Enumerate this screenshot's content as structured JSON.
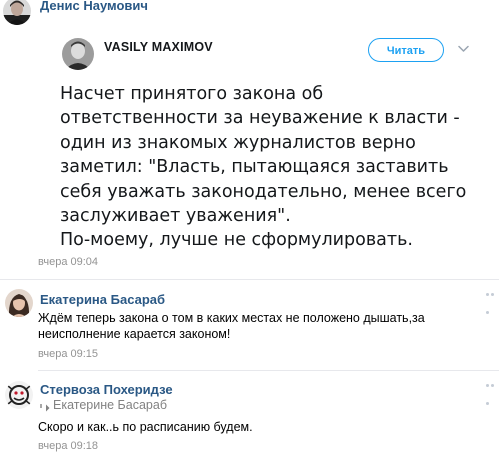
{
  "post": {
    "author": "Денис Наумович",
    "timestamp": "вчера 09:04",
    "tweet": {
      "author": "VASILY MAXIMOV",
      "follow_label": "Читать",
      "text_lines": [
        "Насчет принятого закона об",
        "ответственности за неуважение к власти -",
        "один из знакомых журналистов верно",
        "заметил: \"Власть, пытающаяся заставить",
        "себя уважать законодательно, менее всего",
        "заслуживает уважения\".",
        "По-моему, лучше не сформулировать."
      ]
    }
  },
  "comments": [
    {
      "author": "Екатерина Басараб",
      "text_lines": [
        "Ждём теперь закона о том в каких местах не положено дышать,за",
        "неисполнение карается законом!"
      ],
      "timestamp": "вчера 09:15"
    },
    {
      "author": "Стервоза Похеридзе",
      "reply_to": "Екатерине Басараб",
      "text_lines": [
        "Скоро и как..ь по расписанию будем."
      ],
      "timestamp": "вчера 09:18"
    }
  ],
  "colors": {
    "link": "#2a5885",
    "meta": "#939393",
    "twitter_blue": "#1da1f2",
    "divider": "#e7e8ec"
  }
}
